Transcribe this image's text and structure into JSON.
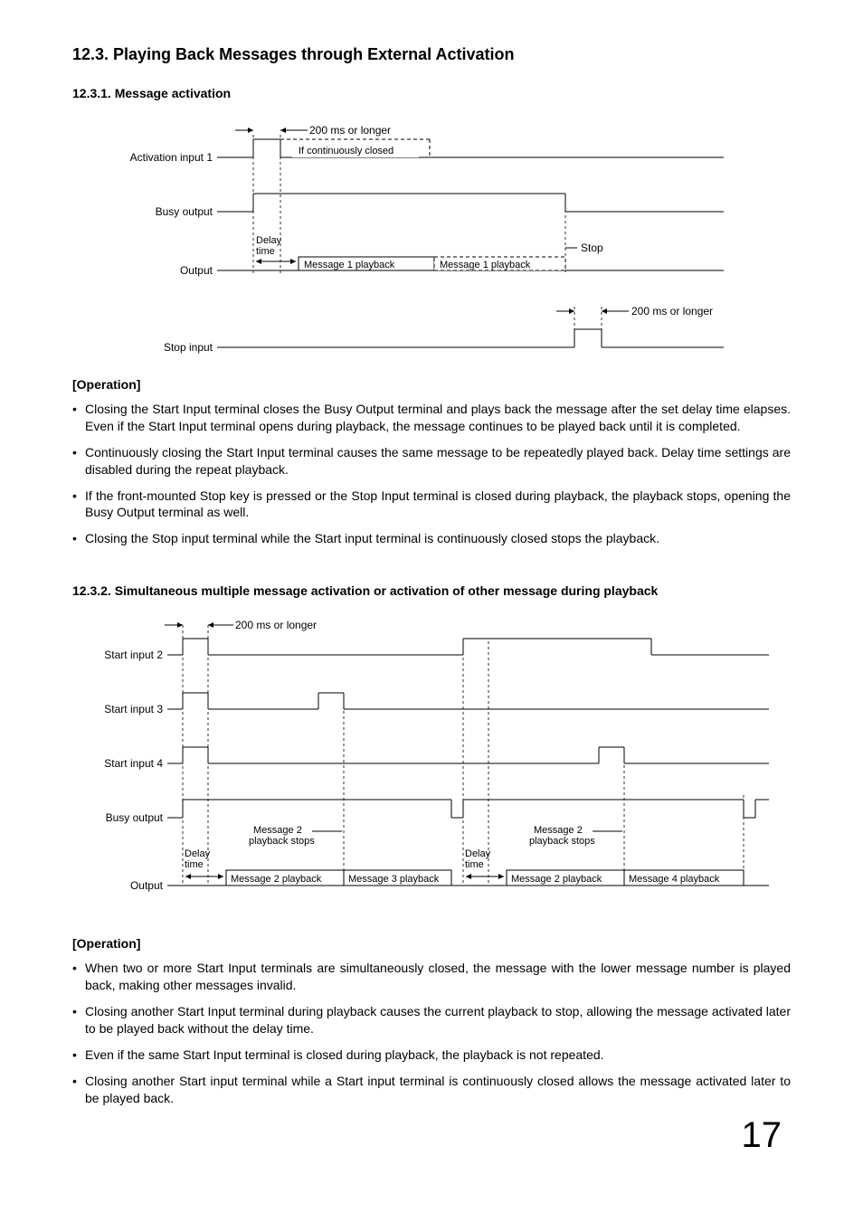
{
  "page_number": "17",
  "section": {
    "title": "12.3. Playing Back Messages through External Activation",
    "sub1": {
      "title": "12.3.1. Message activation",
      "diagram": {
        "labels": {
          "activation_input_1": "Activation input 1",
          "busy_output": "Busy output",
          "output": "Output",
          "stop_input": "Stop input",
          "t200_1": "200 ms or longer",
          "cont_closed": "If continuously closed",
          "delay": "Delay",
          "time": "time",
          "msg1a": "Message 1 playback",
          "msg1b": "Message 1 playback",
          "stop": "Stop",
          "t200_2": "200 ms or longer"
        }
      },
      "operation_heading": "[Operation]",
      "bullets": [
        "Closing the Start Input terminal closes the Busy Output terminal and plays back the message after the set delay time elapses. Even if the Start Input terminal opens during playback, the message continues to be played back until it is completed.",
        "Continuously closing the Start Input terminal causes the same message to be repeatedly played back. Delay time settings are disabled during the repeat playback.",
        "If the front-mounted Stop key is pressed or the Stop Input terminal is closed during playback, the playback stops, opening the Busy Output terminal as well.",
        "Closing the Stop input terminal while the Start input terminal is continuously closed stops the playback."
      ]
    },
    "sub2": {
      "title": "12.3.2. Simultaneous multiple message activation or activation of other message during playback",
      "diagram": {
        "labels": {
          "t200": "200 ms or longer",
          "start_input_2": "Start input 2",
          "start_input_3": "Start input 3",
          "start_input_4": "Start input 4",
          "busy_output": "Busy output",
          "output": "Output",
          "msg2_stops_a": "Message 2",
          "msg2_stops_a2": "playback stops",
          "msg2_stops_b": "Message 2",
          "msg2_stops_b2": "playback stops",
          "delay": "Delay",
          "time": "time",
          "msg2a": "Message 2 playback",
          "msg3": "Message 3 playback",
          "msg2b": "Message 2 playback",
          "msg4": "Message 4 playback"
        }
      },
      "operation_heading": "[Operation]",
      "bullets": [
        "When two or more Start Input terminals are simultaneously closed, the message with the lower message number is played back, making other messages invalid.",
        "Closing another Start Input terminal during playback causes the current playback to stop, allowing the message activated later to be played back without the delay time.",
        "Even if the same Start Input terminal is closed during playback, the playback is not repeated.",
        "Closing another Start input terminal while a Start input terminal is continuously closed allows the message activated later to be played back."
      ]
    }
  }
}
